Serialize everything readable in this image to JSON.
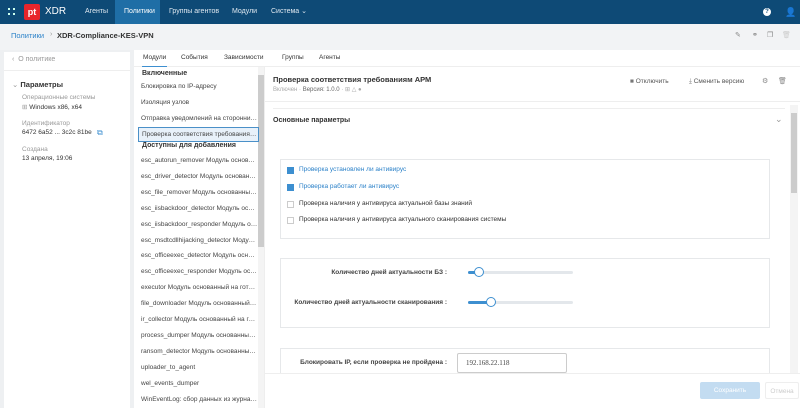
{
  "nav": {
    "logo": "pt",
    "app": "XDR",
    "items": [
      "Агенты",
      "Политики",
      "Группы агентов",
      "Модули",
      "Система"
    ],
    "active": "Политики",
    "icons": [
      "apps-grid-icon",
      "help-icon",
      "user-icon"
    ]
  },
  "breadcrumb": {
    "root": "Политики",
    "current": "XDR-Compliance-KES-VPN"
  },
  "left": {
    "back": "О политике",
    "section": "Параметры",
    "os_label": "Операционные системы",
    "os_value": "Windows x86, x64",
    "id_label": "Идентификатор",
    "id_value": "6472 6a52 ... 3c2c 81be",
    "created_label": "Создана",
    "created_value": "13 апреля, 19:06"
  },
  "tabs": [
    "Модули",
    "События",
    "Зависимости",
    "Группы",
    "Агенты"
  ],
  "modules": {
    "enabled_header": "Включенные",
    "enabled": [
      "Блокировка по IP-адресу",
      "Изоляция узлов",
      "Отправка уведомлений на сторонние системы",
      "Проверка соответствия требованиям АРМ"
    ],
    "selected": 3,
    "available_header": "Доступны для добавления",
    "available": [
      "esc_autorun_remover Модуль основанный на готовом решении",
      "esc_driver_detector Модуль основанный на готовом решении",
      "esc_file_remover Модуль основанный на готовом решении",
      "esc_iisbackdoor_detector Модуль основанный на готовом решении",
      "esc_iisbackdoor_responder Модуль основанный на готовом решении",
      "esc_msdtcdllhijacking_detector Модуль основанный на готовом решении",
      "esc_officeexec_detector Модуль основанный на готовом решении",
      "esc_officeexec_responder Модуль основанный на готовом решении",
      "executor Модуль основанный на готовом решении",
      "file_downloader Модуль основанный на готовом решении",
      "ir_collector Модуль основанный на готовом решении",
      "process_dumper Модуль основанный на готовом решении",
      "ransom_detector Модуль основанный на готовом решении",
      "uploader_to_agent",
      "wel_events_dumper",
      "WinEventLog: сбор данных из журналов"
    ]
  },
  "detail": {
    "title": "Проверка соответствия требованиям АРМ",
    "status": "Включен",
    "version": "Версия: 1.0.0",
    "disable": "Отключить",
    "change_version": "Сменить версию",
    "section": "Основные параметры",
    "checks": [
      {
        "label": "Проверка установлен ли антивирус",
        "checked": true
      },
      {
        "label": "Проверка работает ли антивирус",
        "checked": true
      },
      {
        "label": "Проверка наличия у антивируса актуальной базы знаний",
        "checked": false
      },
      {
        "label": "Проверка наличия у антивируса актуального сканирования системы",
        "checked": false
      }
    ],
    "sliders": [
      {
        "label": "Количество дней актуальности БЗ :",
        "level": 0.1
      },
      {
        "label": "Количество дней актуальности сканирования :",
        "level": 0.22
      }
    ],
    "block_ip_label": "Блокировать IP, если проверка не пройдена :",
    "block_ip_value": "192.168.22.118",
    "save": "Сохранить",
    "cancel": "Отмена"
  },
  "colors": {
    "nav": "#0e4a76",
    "accent": "#3d8fd0",
    "logo": "#e8252b"
  }
}
